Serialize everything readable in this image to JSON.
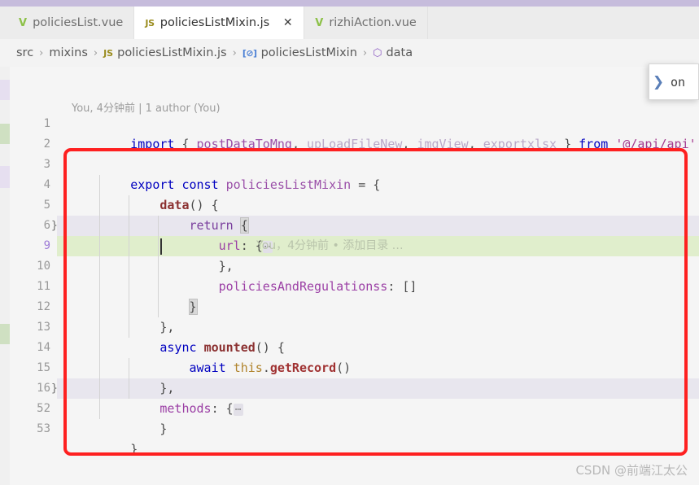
{
  "window": {
    "titlebar_color": "#c6bcdc"
  },
  "tabs": [
    {
      "label": "policiesList.vue",
      "icon": "vue-icon",
      "icon_glyph": "V",
      "active": false,
      "closable": false
    },
    {
      "label": "policiesListMixin.js",
      "icon": "js-icon",
      "icon_glyph": "JS",
      "active": true,
      "closable": true,
      "close_glyph": "✕"
    },
    {
      "label": "rizhiAction.vue",
      "icon": "vue-icon",
      "icon_glyph": "V",
      "active": false,
      "closable": false
    }
  ],
  "breadcrumb": {
    "separator": "›",
    "items": [
      {
        "label": "src",
        "icon": null
      },
      {
        "label": "mixins",
        "icon": null
      },
      {
        "label": "policiesListMixin.js",
        "icon": "js-icon",
        "icon_glyph": "JS"
      },
      {
        "label": "policiesListMixin",
        "icon": "property-icon",
        "icon_glyph": "[⊘]"
      },
      {
        "label": "data",
        "icon": "cube-icon",
        "icon_glyph": "⬡"
      }
    ]
  },
  "editor": {
    "codelens": "You, 4分钟前 | 1 author (You)",
    "blame_annotation": "You，4分钟前  •  添加目录 …",
    "fold_ellipsis": "⋯",
    "line_numbers": [
      "1",
      "2",
      "3",
      "4",
      "5",
      "6",
      "9",
      "10",
      "11",
      "12",
      "13",
      "14",
      "15",
      "16",
      "52",
      "53"
    ],
    "current_line_number": "9",
    "fold_markers": [
      {
        "line_number": "6",
        "glyph": "}"
      },
      {
        "line_number": "16",
        "glyph": "}"
      }
    ],
    "lines": [
      {
        "n": "1",
        "tokens": [
          {
            "t": "import",
            "c": "kw"
          },
          {
            "t": " { ",
            "c": "punc"
          },
          {
            "t": "postDataToMng",
            "c": "var"
          },
          {
            "t": ", ",
            "c": "punc"
          },
          {
            "t": "upLoadFileNew",
            "c": "var-dim"
          },
          {
            "t": ", ",
            "c": "punc"
          },
          {
            "t": "imgView",
            "c": "var-dim"
          },
          {
            "t": ", ",
            "c": "punc"
          },
          {
            "t": "exportxlsx",
            "c": "var-dim"
          },
          {
            "t": " } ",
            "c": "punc"
          },
          {
            "t": "from",
            "c": "kw"
          },
          {
            "t": " ",
            "c": "punc"
          },
          {
            "t": "'@/api/api'",
            "c": "str"
          }
        ]
      },
      {
        "n": "2",
        "tokens": []
      },
      {
        "n": "3",
        "tokens": [
          {
            "t": "export",
            "c": "kw"
          },
          {
            "t": " ",
            "c": "punc"
          },
          {
            "t": "const",
            "c": "kw"
          },
          {
            "t": " ",
            "c": "punc"
          },
          {
            "t": "policiesListMixin",
            "c": "var"
          },
          {
            "t": " = {",
            "c": "punc"
          }
        ]
      },
      {
        "n": "4",
        "tokens": [
          {
            "t": "    ",
            "c": "punc"
          },
          {
            "t": "data",
            "c": "fn"
          },
          {
            "t": "() {",
            "c": "punc"
          }
        ]
      },
      {
        "n": "5",
        "tokens": [
          {
            "t": "        ",
            "c": "punc"
          },
          {
            "t": "return",
            "c": "kw2"
          },
          {
            "t": " ",
            "c": "punc"
          },
          {
            "t": "{",
            "c": "brace-match"
          }
        ]
      },
      {
        "n": "6",
        "tokens": [
          {
            "t": "            ",
            "c": "punc"
          },
          {
            "t": "url",
            "c": "prop"
          },
          {
            "t": ": {",
            "c": "punc"
          }
        ],
        "folded": true
      },
      {
        "n": "9",
        "tokens": [
          {
            "t": "            ",
            "c": "punc"
          },
          {
            "t": "},",
            "c": "punc"
          }
        ],
        "blame": true
      },
      {
        "n": "10",
        "tokens": [
          {
            "t": "            ",
            "c": "punc"
          },
          {
            "t": "policiesAndRegulationss",
            "c": "prop"
          },
          {
            "t": ": []",
            "c": "punc"
          }
        ]
      },
      {
        "n": "11",
        "tokens": [
          {
            "t": "        ",
            "c": "punc"
          },
          {
            "t": "}",
            "c": "brace-match"
          }
        ]
      },
      {
        "n": "12",
        "tokens": [
          {
            "t": "    ",
            "c": "punc"
          },
          {
            "t": "},",
            "c": "punc"
          }
        ]
      },
      {
        "n": "13",
        "tokens": [
          {
            "t": "    ",
            "c": "punc"
          },
          {
            "t": "async",
            "c": "kw"
          },
          {
            "t": " ",
            "c": "punc"
          },
          {
            "t": "mounted",
            "c": "fn"
          },
          {
            "t": "() {",
            "c": "punc"
          }
        ]
      },
      {
        "n": "14",
        "tokens": [
          {
            "t": "        ",
            "c": "punc"
          },
          {
            "t": "await",
            "c": "kw"
          },
          {
            "t": " ",
            "c": "punc"
          },
          {
            "t": "this",
            "c": "this"
          },
          {
            "t": ".",
            "c": "punc"
          },
          {
            "t": "getRecord",
            "c": "fn2"
          },
          {
            "t": "()",
            "c": "punc"
          }
        ]
      },
      {
        "n": "15",
        "tokens": [
          {
            "t": "    ",
            "c": "punc"
          },
          {
            "t": "},",
            "c": "punc"
          }
        ]
      },
      {
        "n": "16",
        "tokens": [
          {
            "t": "    ",
            "c": "punc"
          },
          {
            "t": "methods",
            "c": "prop"
          },
          {
            "t": ": {",
            "c": "punc"
          }
        ],
        "folded": true
      },
      {
        "n": "52",
        "tokens": [
          {
            "t": "    ",
            "c": "punc"
          },
          {
            "t": "}",
            "c": "punc"
          }
        ]
      },
      {
        "n": "53",
        "tokens": [
          {
            "t": "}",
            "c": "punc"
          }
        ]
      }
    ]
  },
  "popup": {
    "chevron": "❯",
    "text": "on"
  },
  "annotation": {
    "highlight_color": "#fe2020"
  },
  "watermark": "CSDN @前端江太公"
}
